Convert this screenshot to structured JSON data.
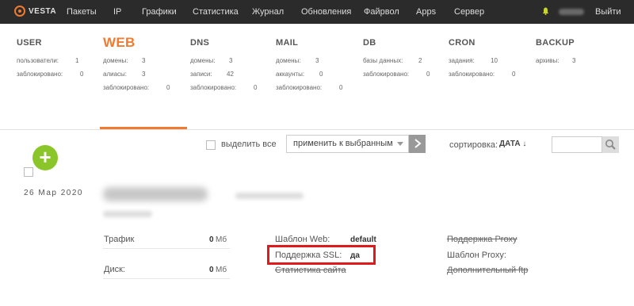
{
  "topbar": {
    "logo_text": "VESTA",
    "menu": [
      "Пакеты",
      "IP",
      "Графики",
      "Статистика",
      "Журнал",
      "Обновления",
      "Файрвол",
      "Apps",
      "Сервер"
    ],
    "logout": "Выйти"
  },
  "stats": {
    "user": {
      "title": "USER",
      "rows": [
        {
          "label": "пользователи:",
          "value": "1"
        },
        {
          "label": "заблокировано:",
          "value": "0"
        }
      ]
    },
    "web": {
      "title": "WEB",
      "rows": [
        {
          "label": "домены:",
          "value": "3"
        },
        {
          "label": "алиасы:",
          "value": "3"
        },
        {
          "label": "заблокировано:",
          "value": "0"
        }
      ]
    },
    "dns": {
      "title": "DNS",
      "rows": [
        {
          "label": "домены:",
          "value": "3"
        },
        {
          "label": "записи:",
          "value": "42"
        },
        {
          "label": "заблокировано:",
          "value": "0"
        }
      ]
    },
    "mail": {
      "title": "MAIL",
      "rows": [
        {
          "label": "домены:",
          "value": "3"
        },
        {
          "label": "аккаунты:",
          "value": "0"
        },
        {
          "label": "заблокировано:",
          "value": "0"
        }
      ]
    },
    "db": {
      "title": "DB",
      "rows": [
        {
          "label": "базы данных:",
          "value": "2"
        },
        {
          "label": "заблокировано:",
          "value": "0"
        }
      ]
    },
    "cron": {
      "title": "CRON",
      "rows": [
        {
          "label": "задания:",
          "value": "10"
        },
        {
          "label": "заблокировано:",
          "value": "0"
        }
      ]
    },
    "backup": {
      "title": "BACKUP",
      "rows": [
        {
          "label": "архивы:",
          "value": "3"
        }
      ]
    }
  },
  "toolbar": {
    "select_all": "выделить все",
    "apply_placeholder": "применить к выбранным",
    "sort_label": "сортировка:",
    "sort_value": "ДАТА ↓"
  },
  "item": {
    "date": "26 Мар 2020",
    "traffic_label": "Трафик",
    "traffic_value": "0",
    "traffic_unit": "Мб",
    "disk_label": "Диск:",
    "disk_value": "0",
    "disk_unit": "Мб",
    "template_web_label": "Шаблон Web:",
    "template_web_value": "default",
    "ssl_label": "Поддержка SSL:",
    "ssl_value": "да",
    "stats_label": "Статистика сайта",
    "proxy_support_label": "Поддержка Proxy",
    "proxy_template_label": "Шаблон Proxy:",
    "ftp_label": "Дополнительный ftp"
  }
}
